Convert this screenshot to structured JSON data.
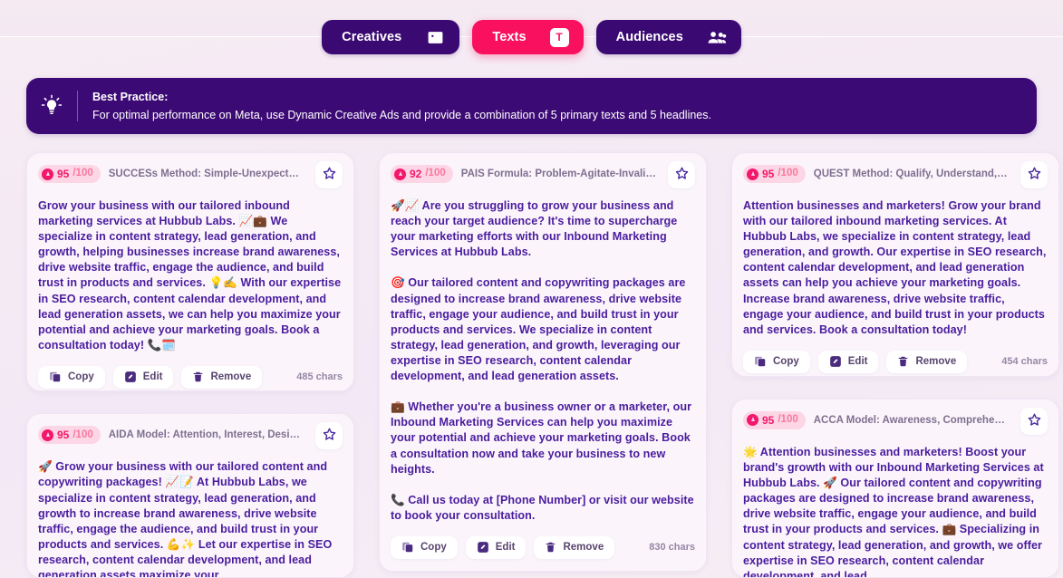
{
  "tabs": [
    {
      "label": "Creatives",
      "icon": "image-icon",
      "active": false
    },
    {
      "label": "Texts",
      "icon": "text-t-icon",
      "active": true
    },
    {
      "label": "Audiences",
      "icon": "people-icon",
      "active": false
    }
  ],
  "banner": {
    "icon": "lightbulb-icon",
    "title": "Best Practice:",
    "text": "For optimal performance on Meta, use Dynamic Creative Ads and provide a combination of 5 primary texts and 5 headlines."
  },
  "actions": {
    "copy": "Copy",
    "edit": "Edit",
    "remove": "Remove"
  },
  "score_max": "/100",
  "columns": [
    {
      "cards": [
        {
          "score": "95",
          "max": "/100",
          "title": "SUCCESs Method: Simple-Unexpected-Concrete-Cr...",
          "body": "Grow your business with our tailored inbound marketing services at Hubbub Labs. 📈💼 We specialize in content strategy, lead generation, and growth, helping businesses increase brand awareness, drive website traffic, engage the audience, and build trust in products and services. 💡✍️ With our expertise in SEO research, content calendar development, and lead generation assets, we can help you maximize your potential and achieve your marketing goals. Book a consultation today! 📞🗓️",
          "chars": "485 chars"
        },
        {
          "score": "95",
          "max": "/100",
          "title": "AIDA Model: Attention, Interest, Desire, Action",
          "body": "🚀 Grow your business with our tailored content and copywriting packages! 📈📝 At Hubbub Labs, we specialize in content strategy, lead generation, and growth to increase brand awareness, drive website traffic, engage the audience, and build trust in your products and services. 💪✨ Let our expertise in SEO research, content calendar development, and lead generation assets maximize your",
          "chars": ""
        }
      ]
    },
    {
      "cards": [
        {
          "score": "92",
          "max": "/100",
          "title": "PAIS Formula: Problem-Agitate-Invalidate-Solve Styl...",
          "body": "🚀📈 Are you struggling to grow your business and reach your target audience? It's time to supercharge your marketing efforts with our Inbound Marketing Services at Hubbub Labs.\n\n🎯 Our tailored content and copywriting packages are designed to increase brand awareness, drive website traffic, engage your audience, and build trust in your products and services. We specialize in content strategy, lead generation, and growth, leveraging our expertise in SEO research, content calendar development, and lead generation assets.\n\n💼 Whether you're a business owner or a marketer, our Inbound Marketing Services can help you maximize your potential and achieve your marketing goals. Book a consultation now and take your business to new heights.\n\n📞 Call us today at [Phone Number] or visit our website to book your consultation.",
          "chars": "830 chars"
        }
      ]
    },
    {
      "cards": [
        {
          "score": "95",
          "max": "/100",
          "title": "QUEST Method: Qualify, Understand, Educate, Stimul...",
          "body": "Attention businesses and marketers! Grow your brand with our tailored inbound marketing services. At Hubbub Labs, we specialize in content strategy, lead generation, and growth. Our expertise in SEO research, content calendar development, and lead generation assets can help you achieve your marketing goals. Increase brand awareness, drive website traffic, engage your audience, and build trust in your products and services. Book a consultation today!",
          "chars": "454 chars"
        },
        {
          "score": "95",
          "max": "/100",
          "title": "ACCA Model: Awareness, Comprehension, Convictio...",
          "body": "🌟 Attention businesses and marketers! Boost your brand's growth with our Inbound Marketing Services at Hubbub Labs. 🚀 Our tailored content and copywriting packages are designed to increase brand awareness, drive website traffic, engage your audience, and build trust in your products and services. 💼 Specializing in content strategy, lead generation, and growth, we offer expertise in SEO research, content calendar development, and lead",
          "chars": ""
        }
      ]
    }
  ],
  "colors": {
    "accent_pink": "#f9115f",
    "purple": "#3a0a72",
    "body_text": "#4a1c9e",
    "score_bg": "#fcd6e4",
    "background": "#f6edf4"
  }
}
